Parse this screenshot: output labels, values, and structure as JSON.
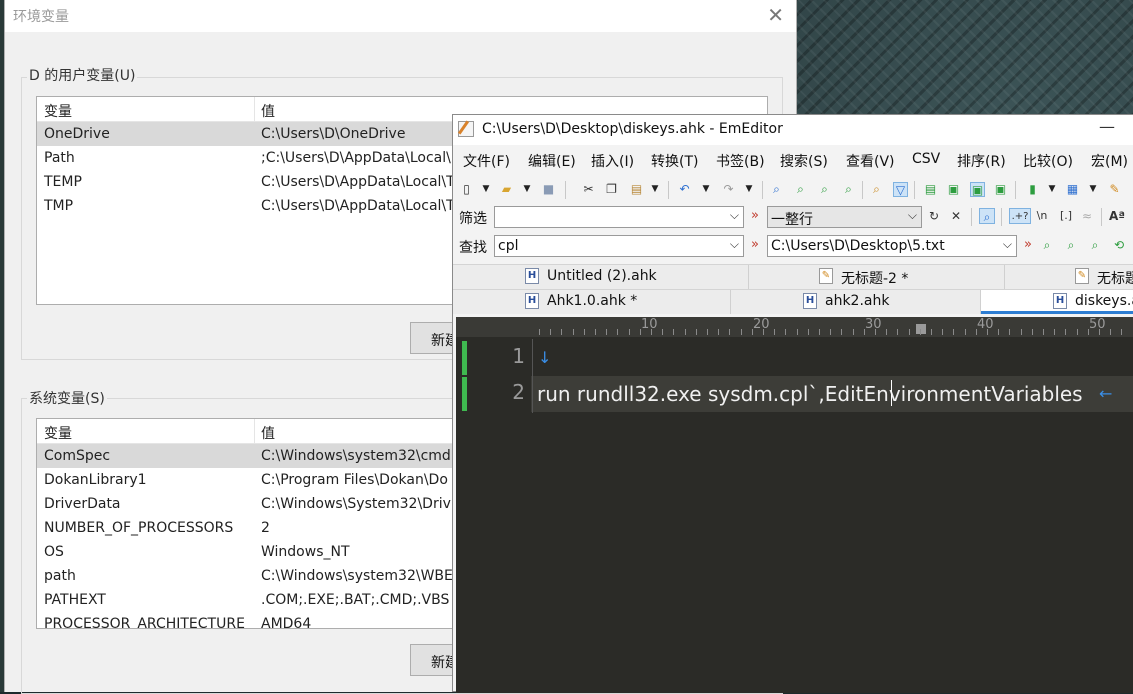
{
  "env_dialog": {
    "title": "环境变量",
    "user_group": {
      "label": "D 的用户变量(U)",
      "columns": [
        "变量",
        "值"
      ],
      "rows": [
        {
          "name": "OneDrive",
          "value": "C:\\Users\\D\\OneDrive"
        },
        {
          "name": "Path",
          "value": ";C:\\Users\\D\\AppData\\Local\\"
        },
        {
          "name": "TEMP",
          "value": "C:\\Users\\D\\AppData\\Local\\T"
        },
        {
          "name": "TMP",
          "value": "C:\\Users\\D\\AppData\\Local\\T"
        }
      ],
      "new_button": "新建"
    },
    "system_group": {
      "label": "系统变量(S)",
      "columns": [
        "变量",
        "值"
      ],
      "rows": [
        {
          "name": "ComSpec",
          "value": "C:\\Windows\\system32\\cmd"
        },
        {
          "name": "DokanLibrary1",
          "value": "C:\\Program Files\\Dokan\\Do"
        },
        {
          "name": "DriverData",
          "value": "C:\\Windows\\System32\\Driv"
        },
        {
          "name": "NUMBER_OF_PROCESSORS",
          "value": "2"
        },
        {
          "name": "OS",
          "value": "Windows_NT"
        },
        {
          "name": "path",
          "value": "C:\\Windows\\system32\\WBE"
        },
        {
          "name": "PATHEXT",
          "value": ".COM;.EXE;.BAT;.CMD;.VBS"
        },
        {
          "name": "PROCESSOR_ARCHITECTURE",
          "value": "AMD64"
        }
      ],
      "new_button": "新建"
    }
  },
  "emeditor": {
    "title": "C:\\Users\\D\\Desktop\\diskeys.ahk - EmEditor",
    "minimize": "—",
    "menu": [
      "文件(F)",
      "编辑(E)",
      "插入(I)",
      "转换(T)",
      "书签(B)",
      "搜索(S)",
      "查看(V)",
      "CSV",
      "排序(R)",
      "比较(O)",
      "宏(M)"
    ],
    "filter_bar": {
      "label": "筛选",
      "value": "",
      "mode": "一整行"
    },
    "find_bar": {
      "label": "查找",
      "value": "cpl",
      "path": "C:\\Users\\D\\Desktop\\5.txt"
    },
    "toolbar_symbols": {
      "regex": ".+?",
      "newline": "\\n",
      "brackets": "[.]"
    },
    "tabs_row1": [
      "Untitled (2).ahk",
      "无标题-2 *",
      "无标题"
    ],
    "tabs_row2": [
      "Ahk1.0.ahk *",
      "ahk2.ahk",
      "diskeys.ahk"
    ],
    "ruler_labels": [
      "10",
      "20",
      "30",
      "40",
      "50"
    ],
    "lines": [
      {
        "number": "1",
        "text": ""
      },
      {
        "number": "2",
        "text": "run rundll32.exe sysdm.cpl`,EditEnvironmentVariables"
      }
    ],
    "eol_down": "↓",
    "eol_left": "←"
  }
}
